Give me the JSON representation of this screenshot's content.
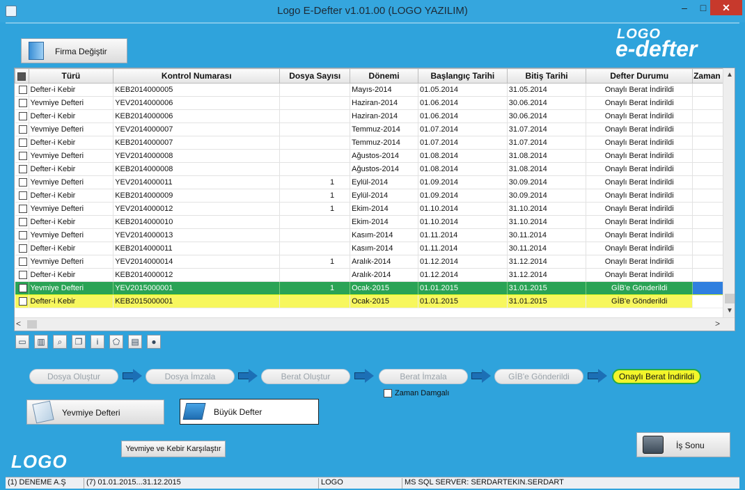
{
  "window": {
    "title": "Logo E-Defter v1.01.00 (LOGO YAZILIM)",
    "minimize": "–",
    "maximize": "□",
    "close": "✕"
  },
  "header": {
    "firma_button": "Firma Değiştir",
    "brand_small": "LOGO",
    "brand_big": "e-defter"
  },
  "table": {
    "columns": [
      "Türü",
      "Kontrol Numarası",
      "Dosya Sayısı",
      "Dönemi",
      "Başlangıç Tarihi",
      "Bitiş Tarihi",
      "Defter Durumu",
      "Zaman"
    ],
    "rows": [
      {
        "turu": "Defter-i Kebir",
        "kontrol": "KEB2014000005",
        "dosya": "",
        "donemi": "Mayıs-2014",
        "baslangic": "01.05.2014",
        "bitis": "31.05.2014",
        "durum": "Onaylı Berat İndirildi"
      },
      {
        "turu": "Yevmiye Defteri",
        "kontrol": "YEV2014000006",
        "dosya": "",
        "donemi": "Haziran-2014",
        "baslangic": "01.06.2014",
        "bitis": "30.06.2014",
        "durum": "Onaylı Berat İndirildi"
      },
      {
        "turu": "Defter-i Kebir",
        "kontrol": "KEB2014000006",
        "dosya": "",
        "donemi": "Haziran-2014",
        "baslangic": "01.06.2014",
        "bitis": "30.06.2014",
        "durum": "Onaylı Berat İndirildi"
      },
      {
        "turu": "Yevmiye Defteri",
        "kontrol": "YEV2014000007",
        "dosya": "",
        "donemi": "Temmuz-2014",
        "baslangic": "01.07.2014",
        "bitis": "31.07.2014",
        "durum": "Onaylı Berat İndirildi"
      },
      {
        "turu": "Defter-i Kebir",
        "kontrol": "KEB2014000007",
        "dosya": "",
        "donemi": "Temmuz-2014",
        "baslangic": "01.07.2014",
        "bitis": "31.07.2014",
        "durum": "Onaylı Berat İndirildi"
      },
      {
        "turu": "Yevmiye Defteri",
        "kontrol": "YEV2014000008",
        "dosya": "",
        "donemi": "Ağustos-2014",
        "baslangic": "01.08.2014",
        "bitis": "31.08.2014",
        "durum": "Onaylı Berat İndirildi"
      },
      {
        "turu": "Defter-i Kebir",
        "kontrol": "KEB2014000008",
        "dosya": "",
        "donemi": "Ağustos-2014",
        "baslangic": "01.08.2014",
        "bitis": "31.08.2014",
        "durum": "Onaylı Berat İndirildi"
      },
      {
        "turu": "Yevmiye Defteri",
        "kontrol": "YEV2014000011",
        "dosya": "1",
        "donemi": "Eylül-2014",
        "baslangic": "01.09.2014",
        "bitis": "30.09.2014",
        "durum": "Onaylı Berat İndirildi"
      },
      {
        "turu": "Defter-i Kebir",
        "kontrol": "KEB2014000009",
        "dosya": "1",
        "donemi": "Eylül-2014",
        "baslangic": "01.09.2014",
        "bitis": "30.09.2014",
        "durum": "Onaylı Berat İndirildi"
      },
      {
        "turu": "Yevmiye Defteri",
        "kontrol": "YEV2014000012",
        "dosya": "1",
        "donemi": "Ekim-2014",
        "baslangic": "01.10.2014",
        "bitis": "31.10.2014",
        "durum": "Onaylı Berat İndirildi"
      },
      {
        "turu": "Defter-i Kebir",
        "kontrol": "KEB2014000010",
        "dosya": "",
        "donemi": "Ekim-2014",
        "baslangic": "01.10.2014",
        "bitis": "31.10.2014",
        "durum": "Onaylı Berat İndirildi"
      },
      {
        "turu": "Yevmiye Defteri",
        "kontrol": "YEV2014000013",
        "dosya": "",
        "donemi": "Kasım-2014",
        "baslangic": "01.11.2014",
        "bitis": "30.11.2014",
        "durum": "Onaylı Berat İndirildi"
      },
      {
        "turu": "Defter-i Kebir",
        "kontrol": "KEB2014000011",
        "dosya": "",
        "donemi": "Kasım-2014",
        "baslangic": "01.11.2014",
        "bitis": "30.11.2014",
        "durum": "Onaylı Berat İndirildi"
      },
      {
        "turu": "Yevmiye Defteri",
        "kontrol": "YEV2014000014",
        "dosya": "1",
        "donemi": "Aralık-2014",
        "baslangic": "01.12.2014",
        "bitis": "31.12.2014",
        "durum": "Onaylı Berat İndirildi"
      },
      {
        "turu": "Defter-i Kebir",
        "kontrol": "KEB2014000012",
        "dosya": "",
        "donemi": "Aralık-2014",
        "baslangic": "01.12.2014",
        "bitis": "31.12.2014",
        "durum": "Onaylı Berat İndirildi"
      },
      {
        "turu": "Yevmiye Defteri",
        "kontrol": "YEV2015000001",
        "dosya": "1",
        "donemi": "Ocak-2015",
        "baslangic": "01.01.2015",
        "bitis": "31.01.2015",
        "durum": "GİB'e Gönderildi"
      },
      {
        "turu": "Defter-i Kebir",
        "kontrol": "KEB2015000001",
        "dosya": "",
        "donemi": "Ocak-2015",
        "baslangic": "01.01.2015",
        "bitis": "31.01.2015",
        "durum": "GİB'e Gönderildi"
      }
    ]
  },
  "workflow": {
    "steps": [
      "Dosya Oluştur",
      "Dosya İmzala",
      "Berat Oluştur",
      "Berat İmzala",
      "GİB'e Gönderildi",
      "Onaylı Berat İndirildi"
    ],
    "zaman_damgali": "Zaman Damgalı"
  },
  "buttons": {
    "yevmiye": "Yevmiye Defteri",
    "buyuk": "Büyük Defter",
    "karsilastir": "Yevmiye ve Kebir Karşılaştır",
    "is_sonu": "İş Sonu"
  },
  "footer_logo": "LOGO",
  "status": {
    "company": "(1) DENEME A.Ş",
    "period": "(7) 01.01.2015...31.12.2015",
    "user": "LOGO",
    "server": "MS SQL SERVER: SERDARTEKIN.SERDART"
  },
  "colors": {
    "background": "#2fa3dc",
    "highlight_green": "#2aa355",
    "highlight_yellow": "#f7f75e",
    "active_step": "#f3f52a"
  }
}
